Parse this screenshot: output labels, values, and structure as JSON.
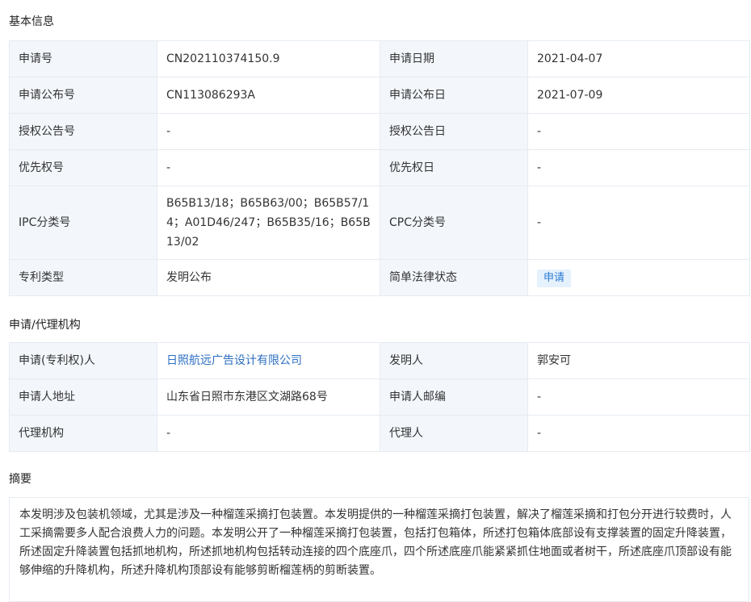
{
  "basic": {
    "title": "基本信息",
    "rows": [
      {
        "k1": "申请号",
        "v1": "CN202110374150.9",
        "k2": "申请日期",
        "v2": "2021-04-07"
      },
      {
        "k1": "申请公布号",
        "v1": "CN113086293A",
        "k2": "申请公布日",
        "v2": "2021-07-09"
      },
      {
        "k1": "授权公告号",
        "v1": "-",
        "k2": "授权公告日",
        "v2": "-"
      },
      {
        "k1": "优先权号",
        "v1": "-",
        "k2": "优先权日",
        "v2": "-"
      },
      {
        "k1": "IPC分类号",
        "v1": "B65B13/18；B65B63/00；B65B57/14；A01D46/247；B65B35/16；B65B13/02",
        "k2": "CPC分类号",
        "v2": "-"
      },
      {
        "k1": "专利类型",
        "v1": "发明公布",
        "k2": "简单法律状态",
        "v2": "申请"
      }
    ]
  },
  "agency": {
    "title": "申请/代理机构",
    "rows": [
      {
        "k1": "申请(专利权)人",
        "v1": "日照航远广告设计有限公司",
        "k2": "发明人",
        "v2": "郭安可"
      },
      {
        "k1": "申请人地址",
        "v1": "山东省日照市东港区文湖路68号",
        "k2": "申请人邮编",
        "v2": "-"
      },
      {
        "k1": "代理机构",
        "v1": "-",
        "k2": "代理人",
        "v2": "-"
      }
    ]
  },
  "abstract": {
    "title": "摘要",
    "text": "本发明涉及包装机领域，尤其是涉及一种榴莲采摘打包装置。本发明提供的一种榴莲采摘打包装置，解决了榴莲采摘和打包分开进行较费时，人工采摘需要多人配合浪费人力的问题。本发明公开了一种榴莲采摘打包装置，包括打包箱体，所述打包箱体底部设有支撑装置的固定升降装置，所述固定升降装置包括抓地机构，所述抓地机构包括转动连接的四个底座爪，四个所述底座爪能紧紧抓住地面或者树干，所述底座爪顶部设有能够伸缩的升降机构，所述升降机构顶部设有能够剪断榴莲柄的剪断装置。"
  }
}
